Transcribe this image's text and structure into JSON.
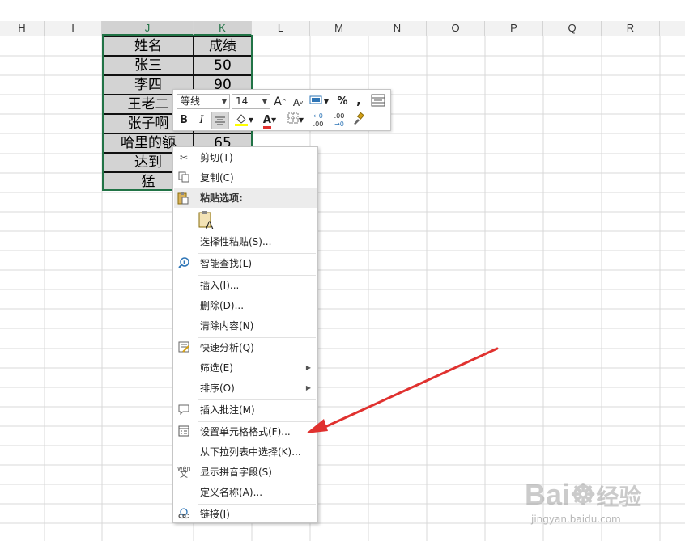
{
  "columns": [
    "H",
    "I",
    "J",
    "K",
    "L",
    "M",
    "N",
    "O",
    "P",
    "Q",
    "R"
  ],
  "table": {
    "header": [
      "姓名",
      "成绩"
    ],
    "rows": [
      [
        "张三",
        "50"
      ],
      [
        "李四",
        "90"
      ],
      [
        "王老二",
        ""
      ],
      [
        "张子啊",
        ""
      ],
      [
        "哈里的额",
        "65"
      ],
      [
        "达到",
        ""
      ],
      [
        "猛",
        ""
      ]
    ]
  },
  "mini_toolbar": {
    "font_name": "等线",
    "font_size": "14",
    "grow_font": "A",
    "shrink_font": "A",
    "percent": "%",
    "comma": ",",
    "bold": "B",
    "italic": "I",
    "font_color": "A",
    "inc_decimal": ".00",
    "dec_decimal": ".00"
  },
  "context_menu": {
    "cut": "剪切(T)",
    "copy": "复制(C)",
    "paste_options": "粘贴选项:",
    "paste_special": "选择性粘贴(S)...",
    "smart_lookup": "智能查找(L)",
    "insert": "插入(I)...",
    "delete": "删除(D)...",
    "clear_contents": "清除内容(N)",
    "quick_analysis": "快速分析(Q)",
    "filter": "筛选(E)",
    "sort": "排序(O)",
    "insert_comment": "插入批注(M)",
    "format_cells": "设置单元格格式(F)...",
    "pick_from_list": "从下拉列表中选择(K)...",
    "show_phonetic": "显示拼音字段(S)",
    "define_name": "定义名称(A)...",
    "link": "链接(I)"
  },
  "colors": {
    "accent": "#217346",
    "arrow": "#e0312f"
  },
  "watermark": {
    "brand": "Bai",
    "brand_cn": "经验",
    "url": "jingyan.baidu.com"
  }
}
